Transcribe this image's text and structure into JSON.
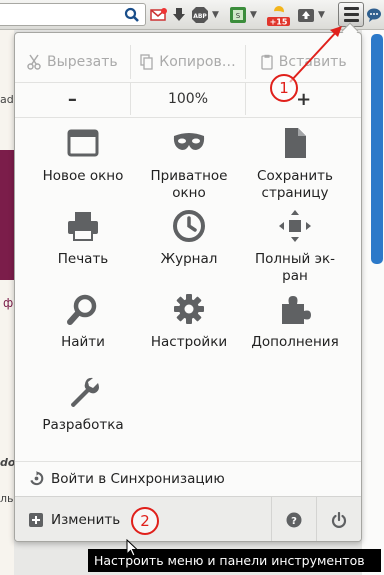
{
  "toolbar": {
    "icons": [
      "search-icon",
      "mail-icon",
      "download-icon",
      "adblock-icon",
      "extension-icon",
      "weather-icon",
      "upload-icon",
      "menu-icon",
      "chat-icon"
    ],
    "adblock_label": "ABP",
    "weather_badge": "+15"
  },
  "background": {
    "left_fragments": [
      "ad",
      "ф",
      "do",
      "ль"
    ]
  },
  "edit": {
    "cut": "Вырезать",
    "copy": "Копиров…",
    "paste": "Вставить"
  },
  "zoom": {
    "minus": "–",
    "level": "100%",
    "plus": "+"
  },
  "items": [
    {
      "label": "Новое окно",
      "icon": "window-icon"
    },
    {
      "label": "Приватное\nокно",
      "icon": "mask-icon"
    },
    {
      "label": "Сохранить\nстраницу",
      "icon": "page-icon"
    },
    {
      "label": "Печать",
      "icon": "printer-icon"
    },
    {
      "label": "Журнал",
      "icon": "clock-icon"
    },
    {
      "label": "Полный эк-\nран",
      "icon": "fullscreen-icon"
    },
    {
      "label": "Найти",
      "icon": "search-icon"
    },
    {
      "label": "Настройки",
      "icon": "gear-icon"
    },
    {
      "label": "Дополнения",
      "icon": "puzzle-icon"
    },
    {
      "label": "Разработка",
      "icon": "wrench-icon"
    }
  ],
  "sync": {
    "label": "Войти в Синхронизацию"
  },
  "footer": {
    "customize": "Изменить",
    "help_icon": "help-icon",
    "quit_icon": "power-icon"
  },
  "tooltip": "Настроить меню и панели инструментов",
  "markers": [
    "1",
    "2"
  ],
  "colors": {
    "accent_red": "#e0201b",
    "icon_gray": "#5f6163",
    "scrollbar": "#2c79c9"
  }
}
